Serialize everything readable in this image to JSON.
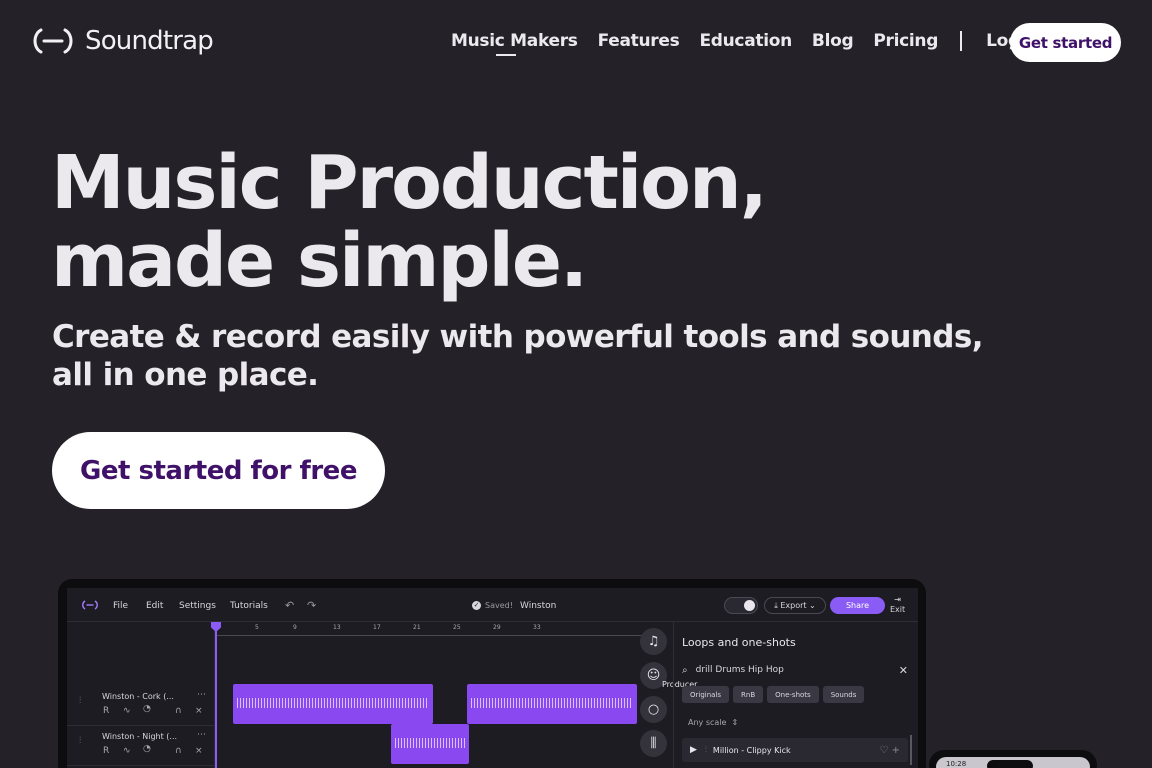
{
  "header": {
    "logo_text": "Soundtrap",
    "nav": [
      "Music Makers",
      "Features",
      "Education",
      "Blog",
      "Pricing"
    ],
    "login": "Log in",
    "cta": "Get started"
  },
  "hero": {
    "title": "Music Production, made simple.",
    "subtitle": "Create & record easily with powerful tools and sounds, all in one place.",
    "cta": "Get started for free"
  },
  "app": {
    "menu": [
      "File",
      "Edit",
      "Settings",
      "Tutorials"
    ],
    "saved": "Saved!",
    "project_name": "Winston",
    "export": "Export",
    "share": "Share",
    "exit": "Exit",
    "ruler": [
      "5",
      "9",
      "13",
      "17",
      "21",
      "25",
      "29",
      "33"
    ],
    "tracks": [
      {
        "name": "Winston - Cork (..."
      },
      {
        "name": "Winston - Night (..."
      }
    ],
    "producer_label": "Producer",
    "loops": {
      "title": "Loops and one-shots",
      "search_value": "drill Drums Hip Hop",
      "chips": [
        "Originals",
        "RnB",
        "One-shots",
        "Sounds"
      ],
      "scale": "Any scale",
      "first_result": "Million - Clippy Kick"
    }
  },
  "phone": {
    "time": "10:28"
  },
  "colors": {
    "background": "#242228",
    "accent": "#8a48f0",
    "cta_text": "#3f1168"
  }
}
